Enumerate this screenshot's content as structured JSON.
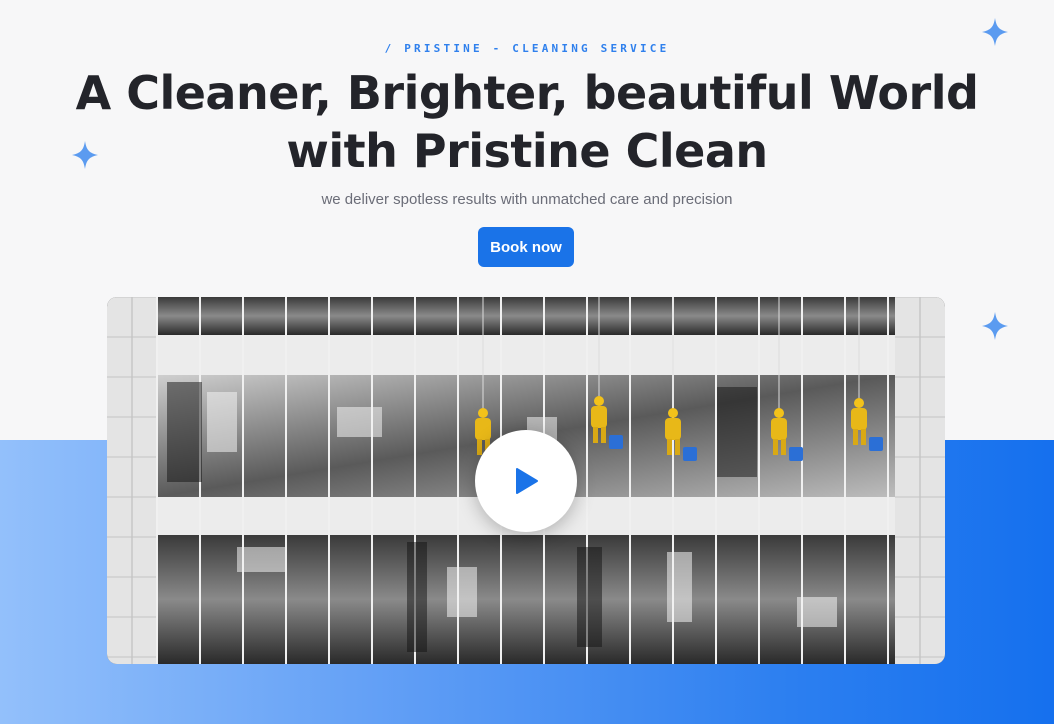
{
  "hero": {
    "eyebrow": "/ PRISTINE - CLEANING SERVICE",
    "title_line1": "A Cleaner, Brighter, beautiful World",
    "title_line2": "with Pristine Clean",
    "subtitle": "we deliver spotless results with unmatched care and precision",
    "cta_label": "Book now"
  },
  "media": {
    "image_icon": "building-window-cleaners-image",
    "play_icon": "play-icon"
  },
  "colors": {
    "accent": "#1a73e8",
    "eyebrow": "#2f80ed",
    "sparkle": "#5b9bf0",
    "band_start": "#93c0fb",
    "band_end": "#1570ee",
    "background": "#f7f7f8"
  }
}
